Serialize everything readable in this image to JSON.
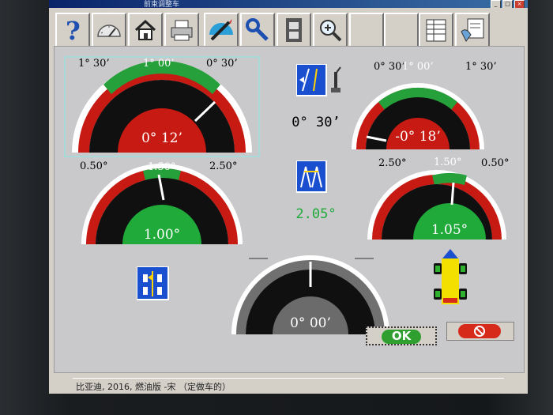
{
  "window": {
    "title": "前束调整车"
  },
  "toolbar": {
    "buttons": [
      {
        "name": "help-button",
        "icon": "question-icon"
      },
      {
        "name": "gauge-button",
        "icon": "speedometer-icon"
      },
      {
        "name": "home-button",
        "icon": "house-icon"
      },
      {
        "name": "print-button",
        "icon": "printer-icon"
      },
      {
        "name": "adjust-button",
        "icon": "pen-ruler-icon"
      },
      {
        "name": "tools-button",
        "icon": "wrench-icon"
      },
      {
        "name": "video-button",
        "icon": "film-icon"
      },
      {
        "name": "zoom-button",
        "icon": "magnifier-plus-icon"
      },
      {
        "name": "report-button",
        "icon": "spreadsheet-icon"
      },
      {
        "name": "settings-button",
        "icon": "hand-document-icon"
      }
    ]
  },
  "gauges": {
    "front_left_camber": {
      "left": "1° 30’",
      "top": "1° 00’",
      "right": "0° 30’",
      "value": "0° 12’",
      "status": "out-of-range"
    },
    "front_right_camber": {
      "left": "0° 30’",
      "top": "1° 00’",
      "right": "1° 30’",
      "value": "-0° 18’",
      "status": "out-of-range"
    },
    "camber_difference": {
      "value": "0° 30’"
    },
    "front_left_caster": {
      "left": "0.50°",
      "top": "1.50°",
      "right": "2.50°",
      "value": "1.00°",
      "status": "in-range"
    },
    "front_right_caster": {
      "left": "2.50°",
      "top": "1.50°",
      "right": "0.50°",
      "value": "1.05°",
      "status": "in-range"
    },
    "caster_difference": {
      "value": "2.05°"
    },
    "thrust_angle": {
      "value": "0° 00’"
    }
  },
  "buttons": {
    "ok_label": "OK",
    "cancel_icon": "no-entry-icon"
  },
  "status": {
    "vehicle": "比亚迪, 2016, 燃油版 -宋 （定做车的）"
  },
  "colors": {
    "ok_green": "#2fa02f",
    "bad_red": "#d62a1a",
    "range_green": "#1f9a2e",
    "panel_gray": "#c9c9cb"
  }
}
